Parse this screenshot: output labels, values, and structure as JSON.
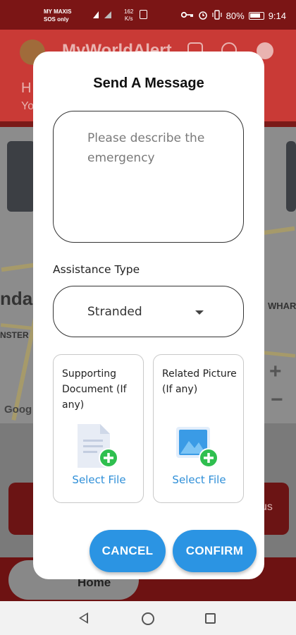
{
  "status_bar": {
    "carrier_line1": "MY MAXIS",
    "carrier_line2": "SOS only",
    "speed_value": "162",
    "speed_unit": "K/s",
    "battery": "80%",
    "time": "9:14"
  },
  "background": {
    "app_title": "MyWorldAlert",
    "greeting_initial": "H",
    "subtitle_initial": "Yo",
    "map_label_left": "nda",
    "map_label_right": "WHAR",
    "map_label_street": "NSTER",
    "map_google": "Goog",
    "card_right_text": "us",
    "nav_home_label": "Home"
  },
  "modal": {
    "title": "Send A Message",
    "message_placeholder": "Please describe the emergency",
    "message_value": "",
    "assistance_label": "Assistance Type",
    "assistance_selected": "Stranded",
    "supporting_doc_label": "Supporting Document (If any)",
    "related_pic_label": "Related Picture (If any)",
    "select_file_label": "Select File",
    "cancel_label": "CANCEL",
    "confirm_label": "CONFIRM"
  },
  "colors": {
    "primary_button": "#2b94e3",
    "link": "#2f8fd8",
    "add_badge": "#2fbf4f",
    "header_red": "#c93a36"
  }
}
